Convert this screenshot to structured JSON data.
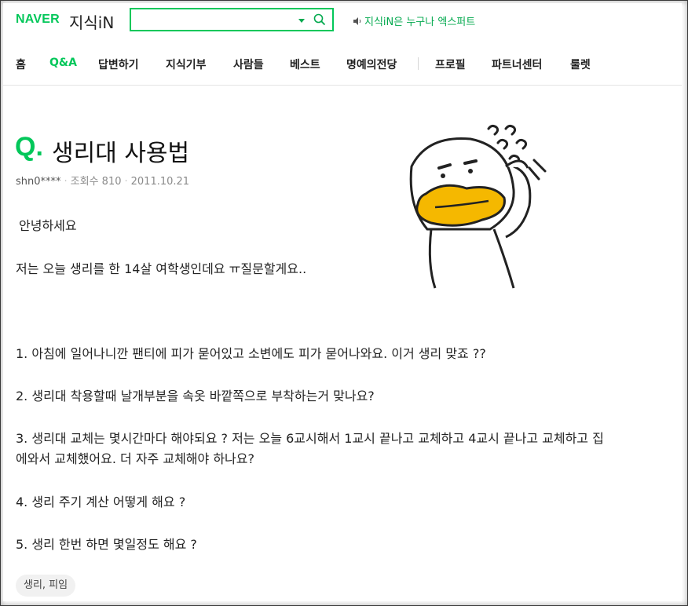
{
  "header": {
    "logo_naver": "NAVER",
    "logo_service": "지식iN",
    "search": {
      "value": "",
      "placeholder": ""
    },
    "promo_text": "지식iN은 누구나 엑스퍼트"
  },
  "nav": {
    "items": [
      {
        "label": "홈"
      },
      {
        "label": "Q&A"
      },
      {
        "label": "답변하기"
      },
      {
        "label": "지식기부"
      },
      {
        "label": "사람들"
      },
      {
        "label": "베스트"
      },
      {
        "label": "명예의전당"
      },
      {
        "label": "프로필"
      },
      {
        "label": "파트너센터"
      },
      {
        "label": "룰렛"
      }
    ],
    "active": "Q&A"
  },
  "question": {
    "q_mark": "Q.",
    "title": "생리대 사용법",
    "author": "shn0****",
    "views": "조회수 810",
    "date": "2011.10.21",
    "greeting": "안녕하세요",
    "intro": "저는 오늘 생리를 한 14살 여학생인데요 ㅠ질문할게요..",
    "items": [
      "1. 아침에 일어나니깐 팬티에 피가 묻어있고 소변에도 피가 묻어나와요. 이거 생리 맞죠 ??",
      "2. 생리대 착용할때 날개부분을 속옷 바깥쪽으로 부착하는거 맞나요?",
      "3. 생리대 교체는 몇시간마다 해야되요 ? 저는 오늘 6교시해서 1교시 끝나고 교체하고 4교시 끝나고 교체하고 집",
      "에와서 교체했어요. 더 자주 교체해야 하나요?",
      "4. 생리 주기 계산 어떻게 해요 ?",
      "5. 생리 한번 하면 몇일정도 해요 ?"
    ],
    "tags": "생리, 피임"
  },
  "colors": {
    "accent": "#03c75a",
    "sticker_bill": "#f5b800"
  }
}
